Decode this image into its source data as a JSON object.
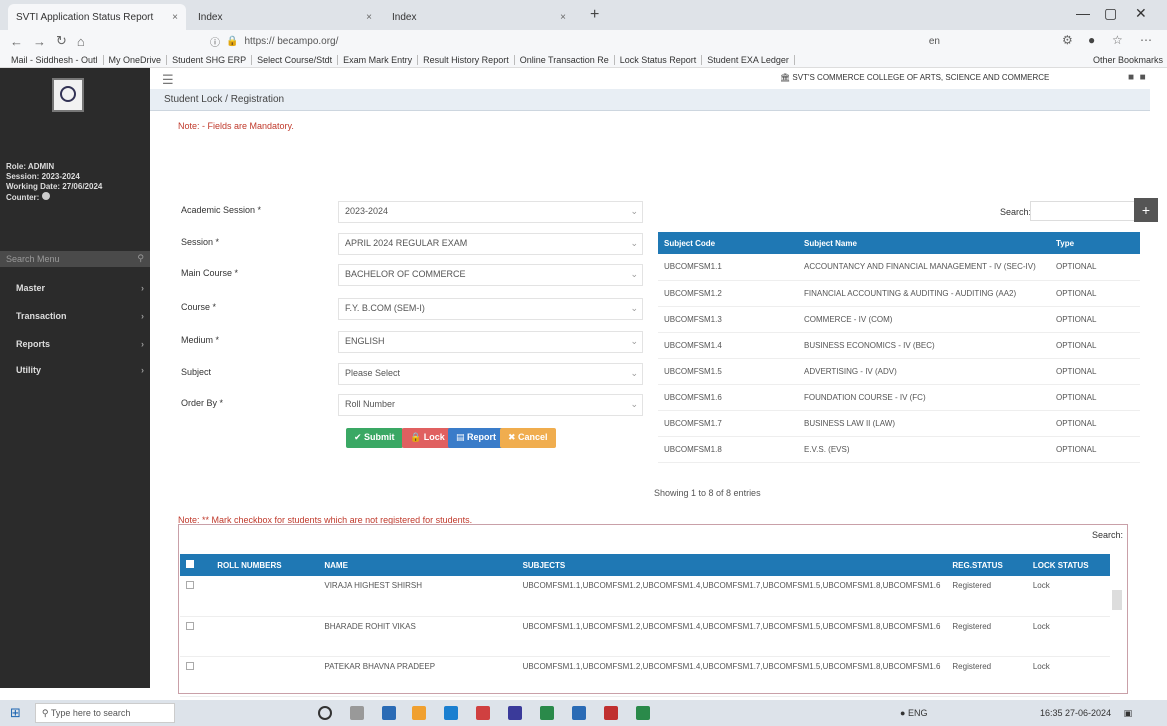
{
  "browser": {
    "tabs": [
      {
        "title": "SVTI Application Status Report",
        "close": "×"
      },
      {
        "title": "Index",
        "close": "×"
      },
      {
        "title": "Index",
        "close": "×"
      }
    ],
    "new_tab": "+",
    "url": "https://          becampo.org/",
    "lang": "en",
    "bookmarks": [
      "Mail - Siddhesh - Outl",
      "My OneDrive",
      "Student SHG ERP",
      "Select Course/Stdt",
      "Exam Mark Entry",
      "Result History Report",
      "Online Transaction Re",
      "Lock Status Report",
      "Student EXA Ledger"
    ],
    "other_bookmarks": "Other Bookmarks"
  },
  "sidebar": {
    "user_lines": [
      "Role: ADMIN",
      "Session: 2023-2024",
      "Working Date: 27/06/2024",
      "Counter:"
    ],
    "search_placeholder": "Search Menu",
    "items": [
      {
        "label": "Master"
      },
      {
        "label": "Transaction"
      },
      {
        "label": "Reports"
      },
      {
        "label": "Utility"
      }
    ]
  },
  "header": {
    "college": "SVT'S COMMERCE COLLEGE OF ARTS, SCIENCE AND COMMERCE"
  },
  "page": {
    "title": "Student Lock / Registration",
    "note_top": "Note: - Fields are Mandatory.",
    "form": [
      {
        "label": "Academic Session *",
        "value": "2023-2024"
      },
      {
        "label": "Session *",
        "value": "APRIL 2024 REGULAR EXAM"
      },
      {
        "label": "Main Course *",
        "value": "BACHELOR OF COMMERCE"
      },
      {
        "label": "Course *",
        "value": "F.Y. B.COM (SEM-I)"
      },
      {
        "label": "Medium *",
        "value": "ENGLISH"
      },
      {
        "label": "Subject",
        "value": "Please Select"
      },
      {
        "label": "Order By *",
        "value": "Roll Number"
      }
    ],
    "buttons": {
      "submit": "Submit",
      "lock": "Lock",
      "report": "Report",
      "cancel": "Cancel"
    }
  },
  "subject_table": {
    "search_label": "Search:",
    "headers": [
      "Subject Code",
      "Subject Name",
      "Type"
    ],
    "rows": [
      [
        "UBCOMFSM1.1",
        "ACCOUNTANCY AND FINANCIAL MANAGEMENT - IV (SEC-IV)",
        "OPTIONAL"
      ],
      [
        "UBCOMFSM1.2",
        "FINANCIAL ACCOUNTING & AUDITING - AUDITING (AA2)",
        "OPTIONAL"
      ],
      [
        "UBCOMFSM1.3",
        "COMMERCE - IV (COM)",
        "OPTIONAL"
      ],
      [
        "UBCOMFSM1.4",
        "BUSINESS ECONOMICS - IV (BEC)",
        "OPTIONAL"
      ],
      [
        "UBCOMFSM1.5",
        "ADVERTISING - IV (ADV)",
        "OPTIONAL"
      ],
      [
        "UBCOMFSM1.6",
        "FOUNDATION COURSE - IV (FC)",
        "OPTIONAL"
      ],
      [
        "UBCOMFSM1.7",
        "BUSINESS LAW II (LAW)",
        "OPTIONAL"
      ],
      [
        "UBCOMFSM1.8",
        "E.V.S. (EVS)",
        "OPTIONAL"
      ]
    ],
    "showing": "Showing 1 to 8 of 8 entries"
  },
  "student_table": {
    "note": "Note: ** Mark checkbox for students which are not registered for students.",
    "search_label": "Search:",
    "headers": [
      "",
      "ROLL NUMBERS",
      "NAME",
      "SUBJECTS",
      "REG.STATUS",
      "LOCK STATUS"
    ],
    "rows": [
      [
        "",
        "",
        "VIRAJA HIGHEST SHIRSH",
        "UBCOMFSM1.1,UBCOMFSM1.2,UBCOMFSM1.4,UBCOMFSM1.7,UBCOMFSM1.5,UBCOMFSM1.8,UBCOMFSM1.6",
        "Registered",
        "Lock"
      ],
      [
        "",
        "",
        "BHARADE ROHIT VIKAS",
        "UBCOMFSM1.1,UBCOMFSM1.2,UBCOMFSM1.4,UBCOMFSM1.7,UBCOMFSM1.5,UBCOMFSM1.8,UBCOMFSM1.6",
        "Registered",
        "Lock"
      ],
      [
        "",
        "",
        "PATEKAR BHAVNA PRADEEP",
        "UBCOMFSM1.1,UBCOMFSM1.2,UBCOMFSM1.4,UBCOMFSM1.7,UBCOMFSM1.5,UBCOMFSM1.8,UBCOMFSM1.6",
        "Registered",
        "Lock"
      ]
    ]
  },
  "taskbar": {
    "search_placeholder": "Type here to search",
    "tray_text": "ENG",
    "time": "16:35",
    "date": "27-06-2024"
  },
  "colors": {
    "primary": "#1f78b4",
    "success": "#3aa864",
    "danger": "#e06060",
    "info": "#3a7cc9",
    "warning": "#f0ad4e",
    "sidebar": "#2b2b2b"
  }
}
